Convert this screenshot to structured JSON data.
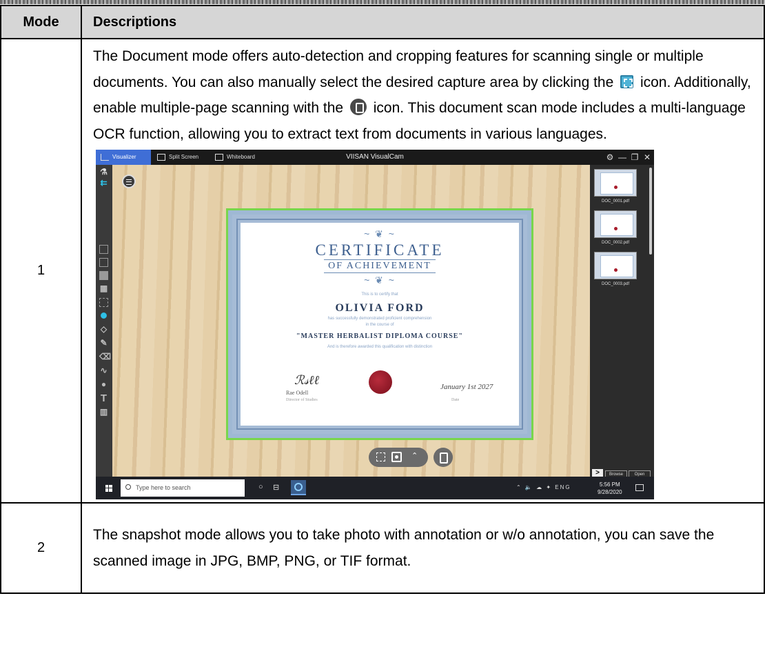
{
  "table": {
    "headers": {
      "mode": "Mode",
      "descriptions": "Descriptions"
    },
    "rows": [
      {
        "mode": "1",
        "desc_parts": [
          "The Document mode offers auto-detection and cropping features for scanning single or multiple documents. You can also manually select the desired capture area by clicking the ",
          " icon. Additionally, enable multiple-page scanning with the ",
          " icon. This document scan mode includes a multi-language OCR function, allowing you to extract text from documents in various languages."
        ],
        "inline_icons": [
          "crop-area-icon",
          "multi-page-icon"
        ]
      },
      {
        "mode": "2",
        "desc": "The snapshot mode allows you to take photo with annotation or w/o annotation, you can save the scanned image in JPG, BMP, PNG, or TIF format."
      }
    ]
  },
  "app": {
    "title": "VIISAN VisualCam",
    "tabs": [
      "Visualizer",
      "Split Screen",
      "Whiteboard"
    ],
    "certificate": {
      "title": "CERTIFICATE",
      "subtitle": "OF ACHIEVEMENT",
      "certify": "This is to certify that",
      "name": "OLIVIA FORD",
      "line1": "has successfully demonstrated proficient comprehension",
      "line2": "in the course of",
      "course": "\"MASTER HERBALIST DIPLOMA COURSE\"",
      "line3": "And is therefore awarded this qualification with distinction",
      "signer": "Rae Odell",
      "role": "Director of Studies",
      "date": "January 1st 2027",
      "date_label": "Date"
    },
    "files": [
      "DOC_0001.pdf",
      "DOC_0002.pdf",
      "DOC_0003.pdf"
    ],
    "panel_buttons": {
      "browse": "Browse",
      "open": "Open"
    },
    "taskbar": {
      "search_placeholder": "Type here to search",
      "lang": "ENG",
      "time": "5:56 PM",
      "date": "9/28/2020"
    }
  }
}
